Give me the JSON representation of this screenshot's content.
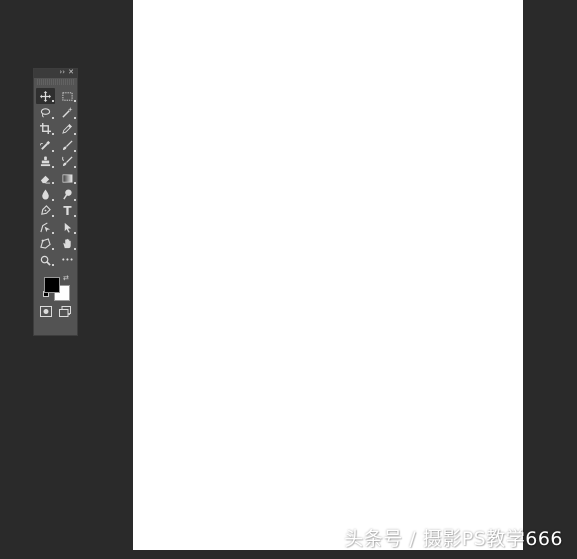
{
  "colors": {
    "workspace_bg": "#2a2a2a",
    "canvas_bg": "#ffffff",
    "toolbar_bg": "#535353",
    "foreground_color": "#000000",
    "background_color": "#ffffff"
  },
  "toolbar": {
    "tools": [
      {
        "name": "move-tool",
        "icon": "move-icon",
        "active": true
      },
      {
        "name": "rectangular-marquee-tool",
        "icon": "marquee-icon"
      },
      {
        "name": "lasso-tool",
        "icon": "lasso-icon"
      },
      {
        "name": "magic-wand-tool",
        "icon": "magic-wand-icon"
      },
      {
        "name": "crop-tool",
        "icon": "crop-icon"
      },
      {
        "name": "eyedropper-tool",
        "icon": "eyedropper-icon"
      },
      {
        "name": "healing-brush-tool",
        "icon": "healing-brush-icon"
      },
      {
        "name": "brush-tool",
        "icon": "brush-icon"
      },
      {
        "name": "clone-stamp-tool",
        "icon": "clone-stamp-icon"
      },
      {
        "name": "history-brush-tool",
        "icon": "history-brush-icon"
      },
      {
        "name": "eraser-tool",
        "icon": "eraser-icon"
      },
      {
        "name": "gradient-tool",
        "icon": "gradient-icon"
      },
      {
        "name": "blur-tool",
        "icon": "blur-icon"
      },
      {
        "name": "dodge-tool",
        "icon": "dodge-icon"
      },
      {
        "name": "pen-tool",
        "icon": "pen-icon"
      },
      {
        "name": "type-tool",
        "icon": "type-icon",
        "glyph": "T"
      },
      {
        "name": "path-selection-tool",
        "icon": "path-selection-icon"
      },
      {
        "name": "direct-selection-tool",
        "icon": "arrow-icon"
      },
      {
        "name": "rectangle-tool",
        "icon": "shape-icon"
      },
      {
        "name": "hand-tool",
        "icon": "hand-icon"
      },
      {
        "name": "zoom-tool",
        "icon": "zoom-icon"
      },
      {
        "name": "more-tools",
        "icon": "ellipsis-icon",
        "glyph": "•••"
      }
    ]
  },
  "watermark": {
    "text": "头条号 / 摄影PS教学666"
  }
}
